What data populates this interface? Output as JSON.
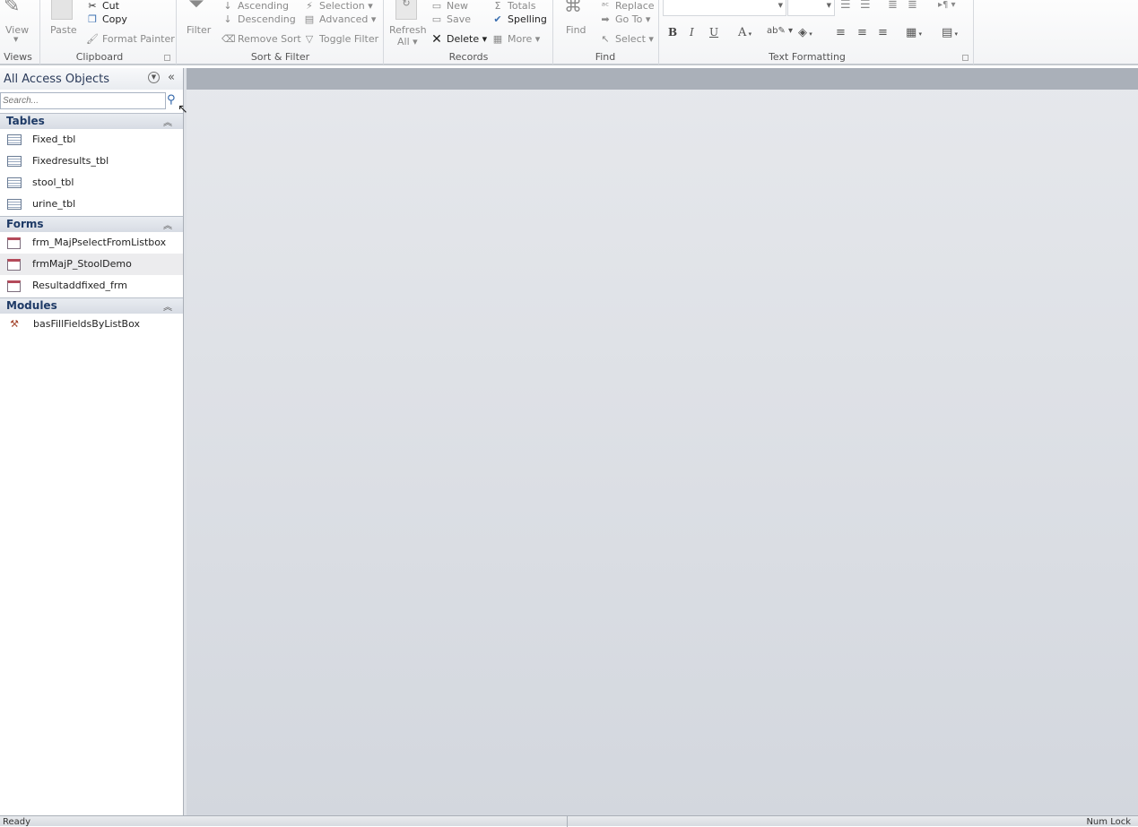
{
  "ribbon": {
    "views": {
      "view": "View",
      "group": "Views"
    },
    "clipboard": {
      "paste": "Paste",
      "cut": "Cut",
      "copy": "Copy",
      "format_painter": "Format Painter",
      "group": "Clipboard"
    },
    "sort_filter": {
      "filter": "Filter",
      "ascending": "Ascending",
      "descending": "Descending",
      "remove_sort": "Remove Sort",
      "selection": "Selection",
      "advanced": "Advanced",
      "toggle_filter": "Toggle Filter",
      "group": "Sort & Filter"
    },
    "records": {
      "refresh": "Refresh",
      "refresh2": "All",
      "new": "New",
      "save": "Save",
      "delete": "Delete",
      "totals": "Totals",
      "spelling": "Spelling",
      "more": "More",
      "group": "Records"
    },
    "find": {
      "find": "Find",
      "replace": "Replace",
      "goto": "Go To",
      "select": "Select",
      "group": "Find"
    },
    "text_formatting": {
      "bold": "B",
      "italic": "I",
      "underline": "U",
      "font_color": "A",
      "group": "Text Formatting"
    }
  },
  "nav": {
    "title": "All Access Objects",
    "search_placeholder": "Search...",
    "categories": [
      {
        "name": "Tables",
        "items": [
          "Fixed_tbl",
          "Fixedresults_tbl",
          "stool_tbl",
          "urine_tbl"
        ]
      },
      {
        "name": "Forms",
        "items": [
          "frm_MajPselectFromListbox",
          "frmMajP_StoolDemo",
          "Resultaddfixed_frm"
        ]
      },
      {
        "name": "Modules",
        "items": [
          "basFillFieldsByListBox"
        ]
      }
    ],
    "selected_item": "frmMajP_StoolDemo"
  },
  "status": {
    "left": "Ready",
    "right": "Num Lock"
  }
}
